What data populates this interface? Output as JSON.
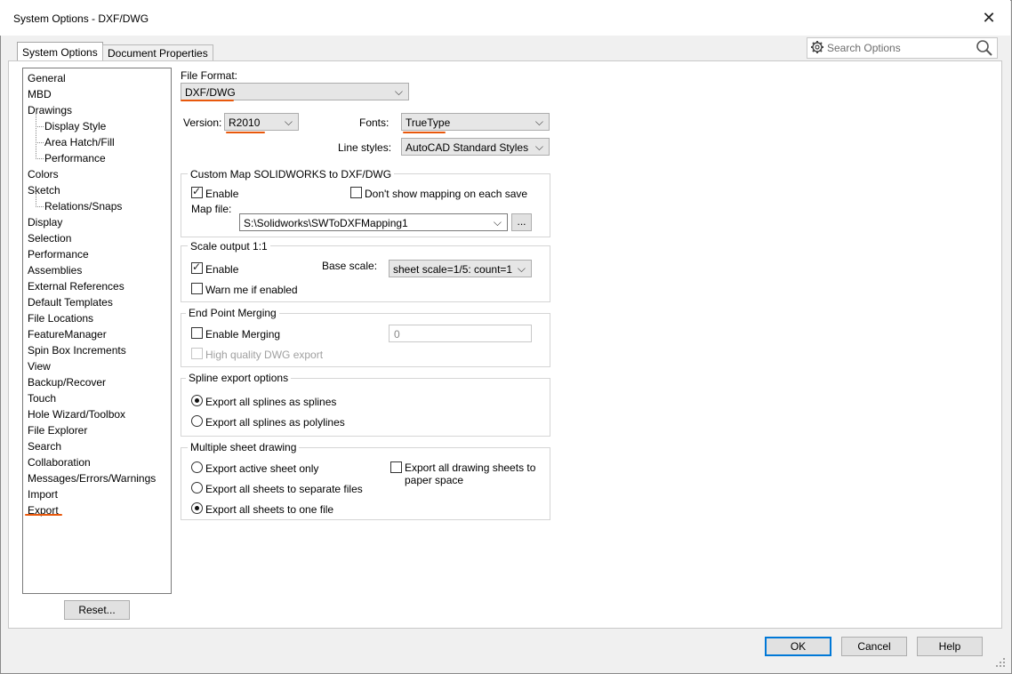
{
  "window": {
    "title": "System Options - DXF/DWG"
  },
  "tabs": [
    "System Options",
    "Document Properties"
  ],
  "search": {
    "placeholder": "Search Options"
  },
  "tree": {
    "items": [
      {
        "label": "General",
        "child": false
      },
      {
        "label": "MBD",
        "child": false
      },
      {
        "label": "Drawings",
        "child": false
      },
      {
        "label": "Display Style",
        "child": true
      },
      {
        "label": "Area Hatch/Fill",
        "child": true
      },
      {
        "label": "Performance",
        "child": true
      },
      {
        "label": "Colors",
        "child": false
      },
      {
        "label": "Sketch",
        "child": false
      },
      {
        "label": "Relations/Snaps",
        "child": true
      },
      {
        "label": "Display",
        "child": false
      },
      {
        "label": "Selection",
        "child": false
      },
      {
        "label": "Performance",
        "child": false
      },
      {
        "label": "Assemblies",
        "child": false
      },
      {
        "label": "External References",
        "child": false
      },
      {
        "label": "Default Templates",
        "child": false
      },
      {
        "label": "File Locations",
        "child": false
      },
      {
        "label": "FeatureManager",
        "child": false
      },
      {
        "label": "Spin Box Increments",
        "child": false
      },
      {
        "label": "View",
        "child": false
      },
      {
        "label": "Backup/Recover",
        "child": false
      },
      {
        "label": "Touch",
        "child": false
      },
      {
        "label": "Hole Wizard/Toolbox",
        "child": false
      },
      {
        "label": "File Explorer",
        "child": false
      },
      {
        "label": "Search",
        "child": false
      },
      {
        "label": "Collaboration",
        "child": false
      },
      {
        "label": "Messages/Errors/Warnings",
        "child": false
      },
      {
        "label": "Import",
        "child": false
      },
      {
        "label": "Export",
        "child": false
      }
    ]
  },
  "reset_label": "Reset...",
  "file_format": {
    "label": "File Format:",
    "value": "DXF/DWG"
  },
  "version": {
    "label": "Version:",
    "value": "R2010"
  },
  "fonts": {
    "label": "Fonts:",
    "value": "TrueType"
  },
  "line_styles": {
    "label": "Line styles:",
    "value": "AutoCAD Standard Styles"
  },
  "custom_map": {
    "title": "Custom Map SOLIDWORKS to DXF/DWG",
    "enable_label": "Enable",
    "enable_checked": true,
    "dont_show_label": "Don't show mapping on each save",
    "dont_show_checked": false,
    "map_file_label": "Map file:",
    "map_file_value": "S:\\Solidworks\\SWToDXFMapping1",
    "browse_label": "..."
  },
  "scale": {
    "title": "Scale output 1:1",
    "enable_label": "Enable",
    "enable_checked": true,
    "base_scale_label": "Base scale:",
    "base_scale_value": "sheet scale=1/5: count=1",
    "warn_label": "Warn me if enabled",
    "warn_checked": false
  },
  "end_point": {
    "title": "End Point Merging",
    "enable_label": "Enable Merging",
    "enable_checked": false,
    "value": "0",
    "hq_label": "High quality DWG export"
  },
  "spline": {
    "title": "Spline export options",
    "opt1": "Export all splines as splines",
    "opt2": "Export all splines as polylines",
    "selected": 0
  },
  "multi_sheet": {
    "title": "Multiple sheet drawing",
    "opt1": "Export active sheet only",
    "opt2": "Export all sheets to separate files",
    "opt3": "Export all sheets to one file",
    "selected": 2,
    "paper_space_line1": "Export all drawing sheets to",
    "paper_space_line2": "paper space",
    "paper_space_checked": false
  },
  "buttons": {
    "ok": "OK",
    "cancel": "Cancel",
    "help": "Help"
  },
  "colors": {
    "annotation": "#e8580c",
    "focus": "#0078d7"
  },
  "icons": [
    "gear-icon",
    "search-icon",
    "close-icon",
    "chevron-down-icon",
    "resize-grip-icon"
  ]
}
